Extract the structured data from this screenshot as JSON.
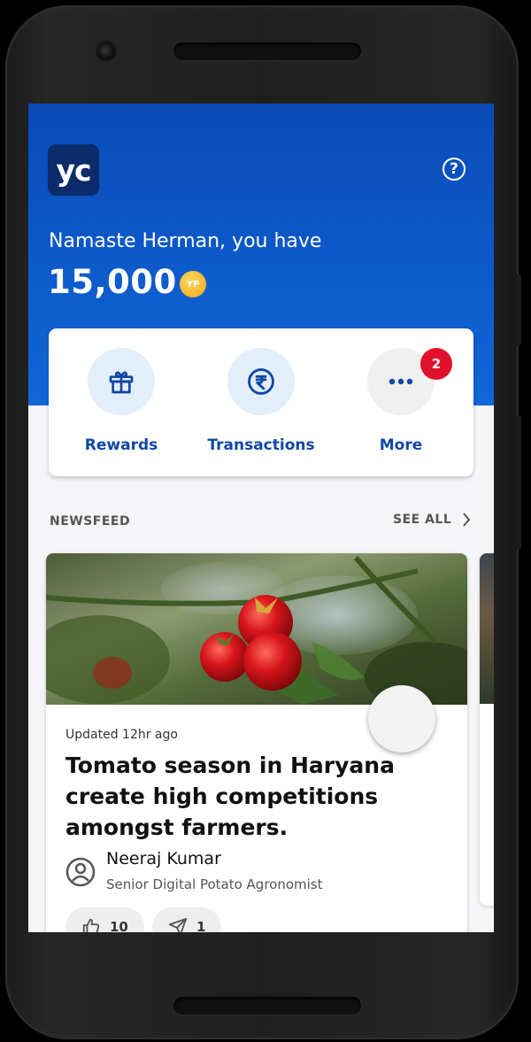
{
  "header": {
    "logo_text": "yc",
    "greeting": "Namaste Herman, you have",
    "points": "15,000",
    "coin_label": "YP"
  },
  "actions": [
    {
      "label": "Rewards",
      "icon": "gift-icon"
    },
    {
      "label": "Transactions",
      "icon": "rupee-icon"
    },
    {
      "label": "More",
      "icon": "more-dots-icon",
      "badge": "2"
    }
  ],
  "newsfeed": {
    "title": "NEWSFEED",
    "see_all": "SEE ALL",
    "card": {
      "updated": "Updated 12hr ago",
      "headline": "Tomato season in Haryana create high competitions amongst farmers.",
      "author": "Neeraj Kumar",
      "role": "Senior Digital Potato Agronomist",
      "likes": "10",
      "shares": "1"
    }
  },
  "colors": {
    "brand_blue": "#0d5acb",
    "action_text": "#0f47a3",
    "badge_red": "#e0112a",
    "coin_gold": "#f1a91a"
  }
}
